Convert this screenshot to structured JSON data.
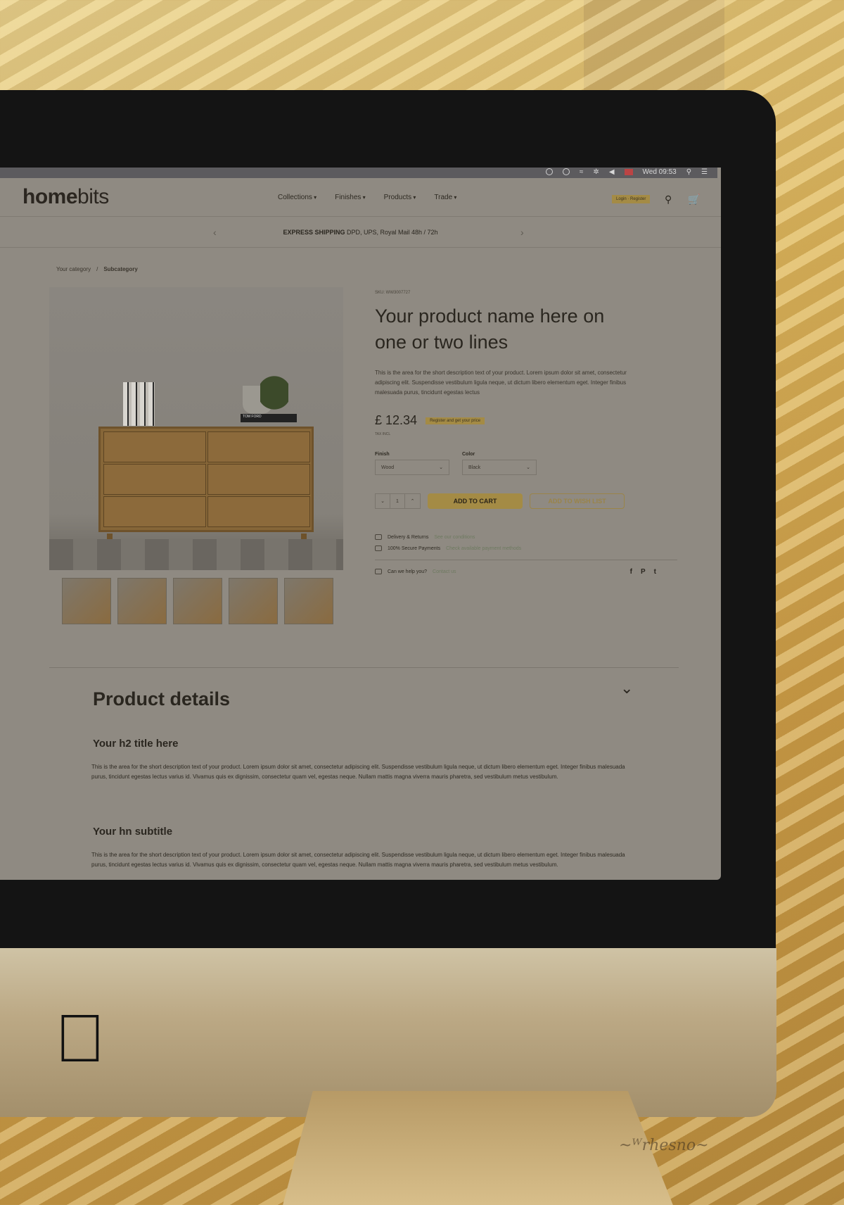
{
  "menubar": {
    "clock": "Wed 09:53"
  },
  "site": {
    "logo_bold": "home",
    "logo_light": "bits",
    "nav": [
      "Collections",
      "Finishes",
      "Products",
      "Trade"
    ],
    "login": "Login · Register",
    "promo_bold": "EXPRESS SHIPPING",
    "promo_text": " DPD, UPS, Royal Mail 48h / 72h"
  },
  "breadcrumb": {
    "category": "Your category",
    "separator": "/",
    "subcategory": "Subcategory"
  },
  "product": {
    "sku": "SKU: WW3007727",
    "title": "Your product name here on one or two lines",
    "short_desc": "This is the area for the short description text of your product. Lorem ipsum dolor sit amet, consectetur adipiscing elit. Suspendisse vestibulum ligula neque, ut dictum libero elementum eget. Integer finibus malesuada purus, tincidunt egestas lectus",
    "price": "£ 12.34",
    "price_badge": "Register and get your price",
    "tax": "TAX INCL",
    "finish_label": "Finish",
    "finish_value": "Wood",
    "color_label": "Color",
    "color_value": "Black",
    "qty": "1",
    "qty_minus": "⌄",
    "qty_plus": "⌃",
    "add_to_cart": "ADD TO CART",
    "add_to_wishlist": "ADD TO WISH LIST",
    "book_label": "TOM FORD"
  },
  "info": {
    "delivery": "Delivery & Returns",
    "delivery_link": "See our conditions",
    "payments": "100% Secure Payments",
    "payments_link": "Check available payment methods",
    "help": "Can we help you?",
    "help_link": "Contact us",
    "social": [
      "f",
      "P",
      "t"
    ]
  },
  "details": {
    "title": "Product details",
    "h2": "Your h2 title here",
    "p1": "This is the area for the short description text of your product. Lorem ipsum dolor sit amet, consectetur adipiscing elit. Suspendisse vestibulum ligula neque, ut dictum libero elementum eget. Integer finibus malesuada purus, tincidunt egestas lectus varius id. Vivamus quis ex dignissim, consectetur quam vel, egestas neque. Nullam mattis magna viverra mauris pharetra, sed vestibulum metus vestibulum.",
    "hn": "Your hn subtitle",
    "p2": "This is the area for the short description text of your product. Lorem ipsum dolor sit amet, consectetur adipiscing elit. Suspendisse vestibulum ligula neque, ut dictum libero elementum eget. Integer finibus malesuada purus, tincidunt egestas lectus varius id. Vivamus quis ex dignissim, consectetur quam vel, egestas neque. Nullam mattis magna viverra mauris pharetra, sed vestibulum metus vestibulum."
  },
  "colors": {
    "accent": "#a48b45",
    "screen_bg": "#8f8a82",
    "text": "#2a261f"
  },
  "icons": {
    "search": "search-icon",
    "cart": "cart-icon",
    "chevron": "chevron-down-icon",
    "apple": "apple-logo-icon"
  }
}
